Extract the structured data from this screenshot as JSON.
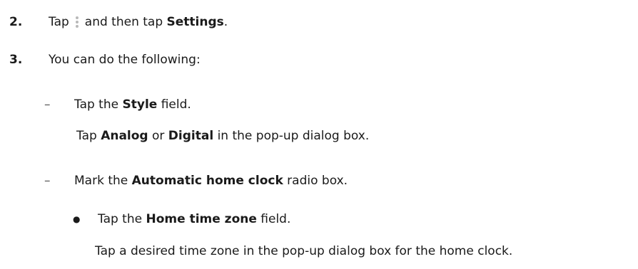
{
  "steps": [
    {
      "number": "2.",
      "pre": "Tap",
      "icon": "more-vertical-icon",
      "mid": "and then tap",
      "bold": "Settings",
      "post": "."
    },
    {
      "number": "3.",
      "text": "You can do the following:"
    }
  ],
  "substeps": [
    {
      "marker": "–",
      "pre": "Tap the",
      "bold": "Style",
      "post": "field.",
      "detail": {
        "pre": "Tap",
        "bold1": "Analog",
        "mid": "or",
        "bold2": "Digital",
        "post": "in the pop-up dialog box."
      }
    },
    {
      "marker": "–",
      "pre": "Mark the",
      "bold": "Automatic home clock",
      "post": "radio box.",
      "bullet": {
        "marker": "●",
        "pre": "Tap the",
        "bold": "Home time zone",
        "post": "field.",
        "detail": "Tap a desired time zone in the pop-up dialog box for the home clock."
      }
    }
  ]
}
